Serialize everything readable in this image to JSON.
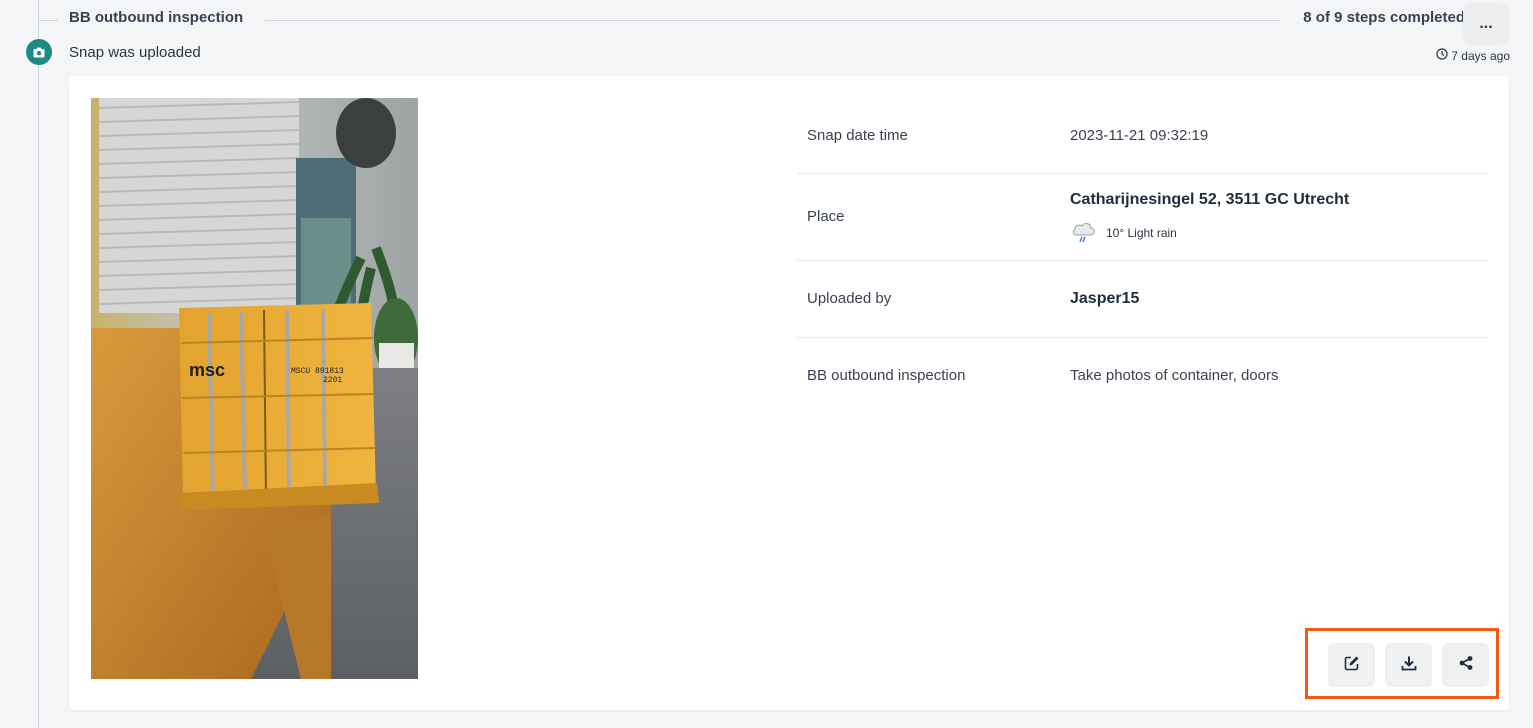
{
  "section": {
    "title": "BB outbound inspection",
    "steps_text": "8 of 9 steps completed",
    "more_label": "..."
  },
  "event": {
    "title": "Snap was uploaded",
    "icon": "camera-icon",
    "time_ago": "7 days ago"
  },
  "details": {
    "rows": [
      {
        "label": "Snap date time",
        "value": "2023-11-21 09:32:19"
      },
      {
        "label": "Place",
        "value": "Catharijnesingel 52, 3511 GC Utrecht",
        "weather": "10° Light rain"
      },
      {
        "label": "Uploaded by",
        "value": "Jasper15"
      },
      {
        "label": "BB outbound inspection",
        "value": "Take photos of container, doors"
      }
    ]
  },
  "photo": {
    "container_text_1": "msc",
    "container_text_2": "MSCU 891813",
    "container_text_3": "2201"
  },
  "actions": [
    {
      "name": "edit",
      "icon": "edit-icon"
    },
    {
      "name": "download",
      "icon": "download-icon"
    },
    {
      "name": "share",
      "icon": "share-icon"
    }
  ],
  "colors": {
    "accent_teal": "#1d8a86",
    "highlight_orange": "#ef5a16"
  }
}
